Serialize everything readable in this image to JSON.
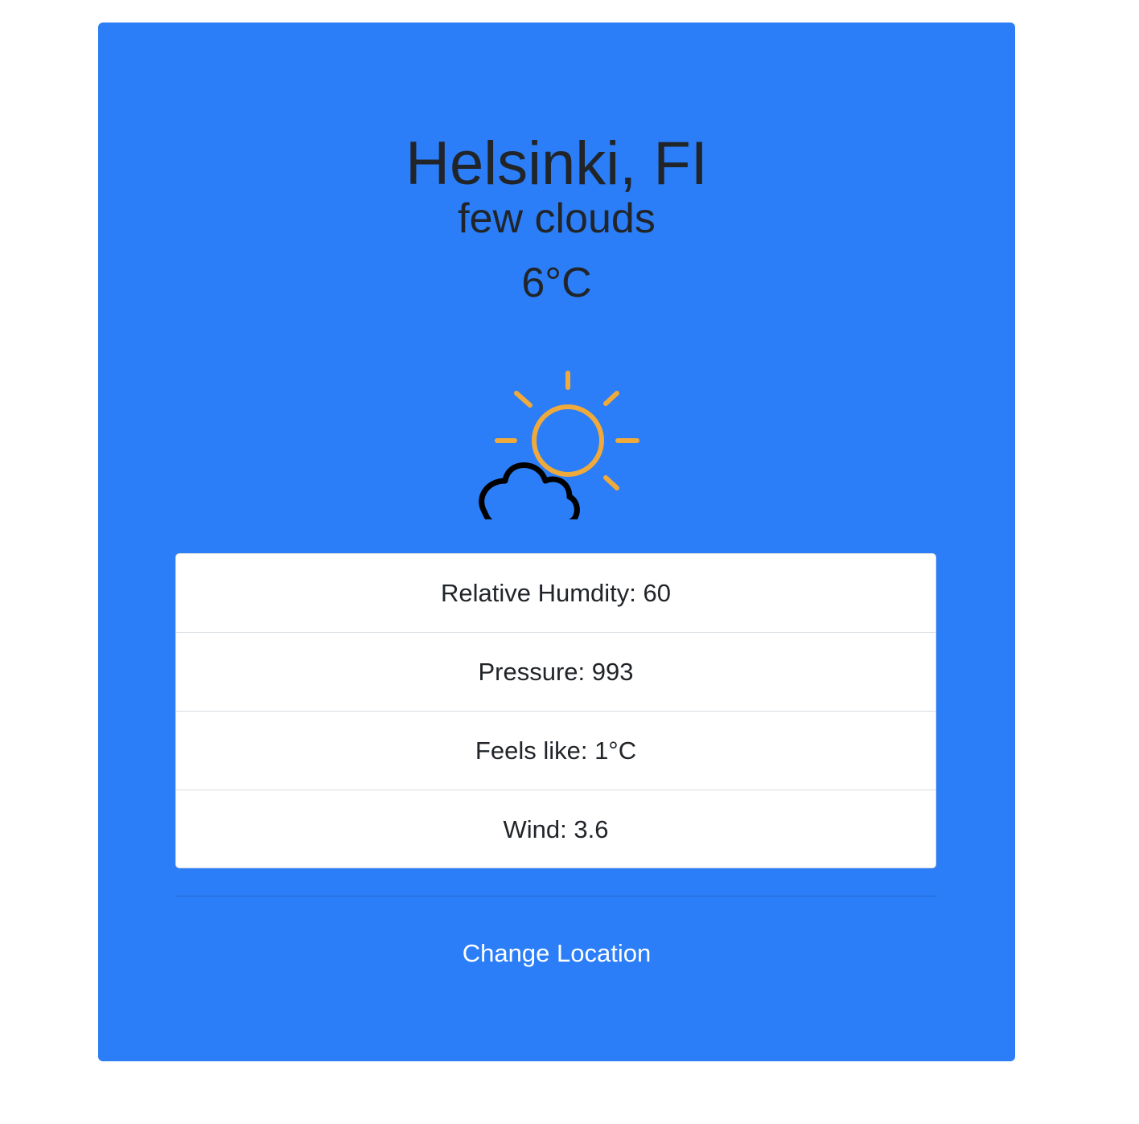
{
  "weather": {
    "location": "Helsinki, FI",
    "description": "few clouds",
    "temperature": "6°C",
    "icon": "partly-cloudy-icon"
  },
  "details": [
    {
      "text": "Relative Humdity: 60"
    },
    {
      "text": "Pressure: 993"
    },
    {
      "text": "Feels like: 1°C"
    },
    {
      "text": "Wind: 3.6"
    }
  ],
  "actions": {
    "change_location_label": "Change Location"
  },
  "colors": {
    "card_background": "#2b7ef7",
    "sun": "#f0a93b",
    "cloud_outline": "#000000",
    "text": "#212529",
    "link": "#ffffff"
  }
}
